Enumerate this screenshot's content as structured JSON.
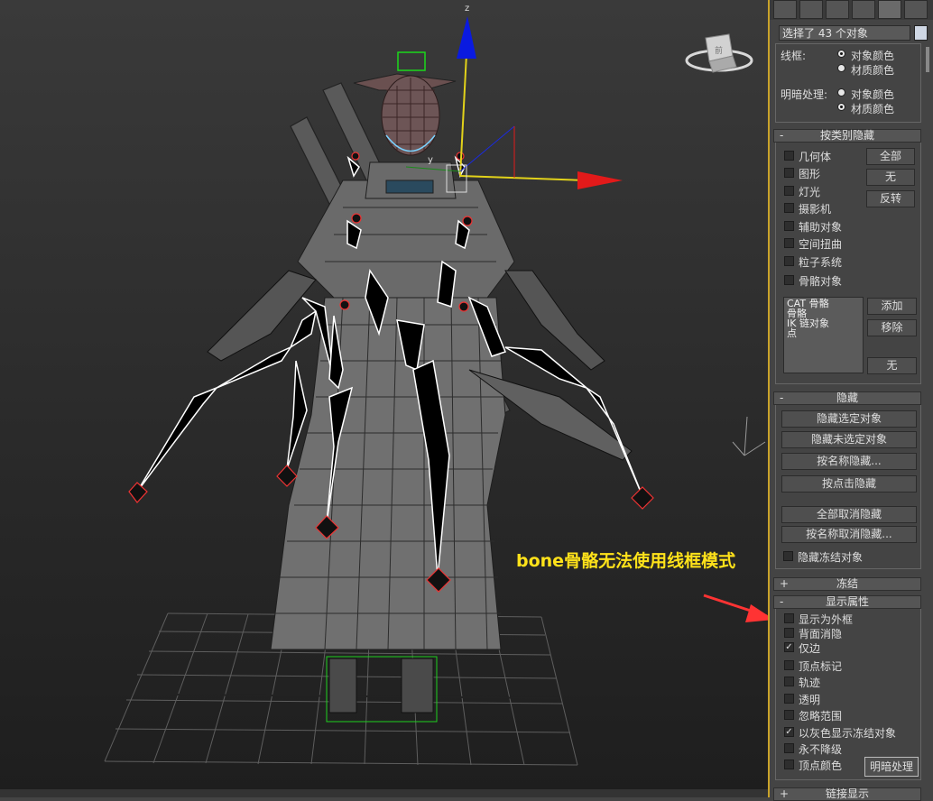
{
  "viewport": {
    "axis_label_z": "z",
    "axis_label_y": "y",
    "annotation": "bone骨骼无法使用线框模式",
    "viewcube_label": "前"
  },
  "panel": {
    "selection_field": "选择了 43 个对象",
    "display_color": {
      "wireframe_label": "线框:",
      "wireframe_opt1": "对象颜色",
      "wireframe_opt2": "材质颜色",
      "shaded_label": "明暗处理:",
      "shaded_opt1": "对象颜色",
      "shaded_opt2": "材质颜色"
    },
    "hide_by_category": {
      "title": "按类别隐藏",
      "items": [
        "几何体",
        "图形",
        "灯光",
        "摄影机",
        "辅助对象",
        "空间扭曲",
        "粒子系统",
        "骨骼对象"
      ],
      "btn_all": "全部",
      "btn_none": "无",
      "btn_invert": "反转",
      "list": [
        "CAT 骨骼",
        "骨骼",
        "IK 链对象",
        "点"
      ],
      "btn_add": "添加",
      "btn_remove": "移除",
      "btn_none2": "无"
    },
    "hide": {
      "title": "隐藏",
      "buttons": [
        "隐藏选定对象",
        "隐藏未选定对象",
        "按名称隐藏...",
        "按点击隐藏",
        "全部取消隐藏",
        "按名称取消隐藏..."
      ],
      "freeze_label": "隐藏冻结对象"
    },
    "freeze": {
      "title": "冻结"
    },
    "display_props": {
      "title": "显示属性",
      "items": [
        {
          "label": "显示为外框",
          "checked": false
        },
        {
          "label": "背面消隐",
          "checked": false
        },
        {
          "label": "仅边",
          "checked": true
        },
        {
          "label": "顶点标记",
          "checked": false
        },
        {
          "label": "轨迹",
          "checked": false
        },
        {
          "label": "透明",
          "checked": false
        },
        {
          "label": "忽略范围",
          "checked": false
        },
        {
          "label": "以灰色显示冻结对象",
          "checked": true
        },
        {
          "label": "永不降级",
          "checked": false
        },
        {
          "label": "顶点颜色",
          "checked": false
        }
      ],
      "shade_button": "明暗处理"
    },
    "link_display": {
      "title": "链接显示"
    }
  }
}
